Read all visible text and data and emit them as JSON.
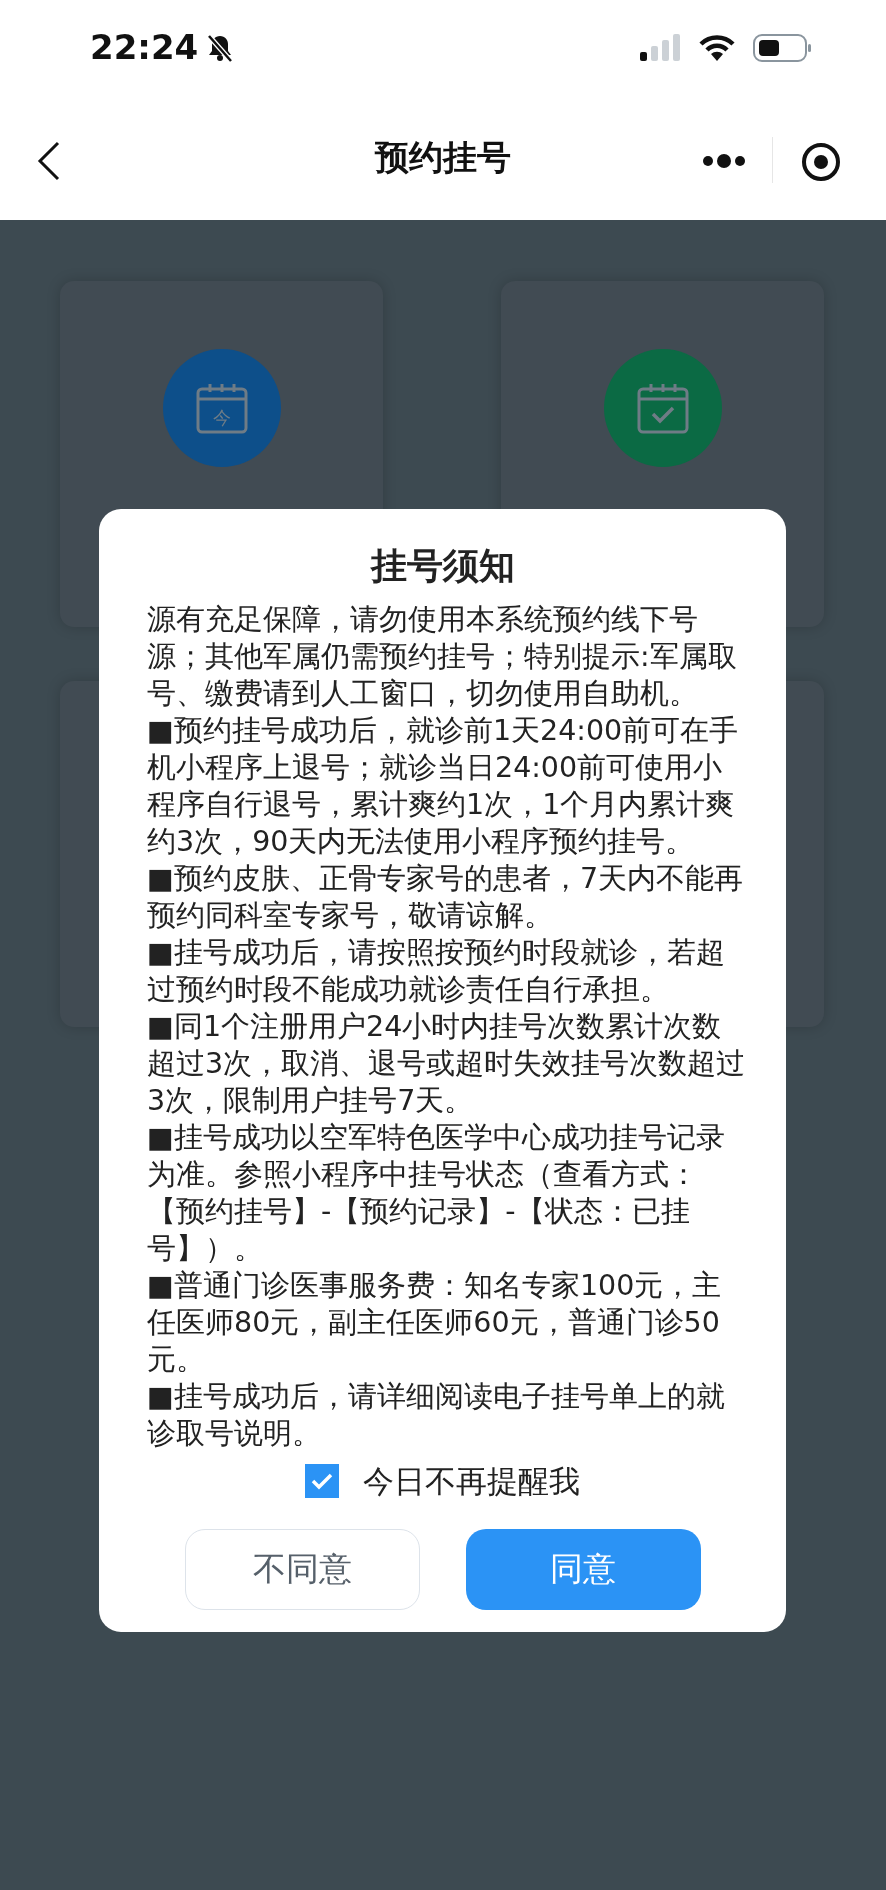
{
  "status_bar": {
    "time": "22:24"
  },
  "nav": {
    "title": "预约挂号"
  },
  "tiles": [
    {
      "kind": "today",
      "color": "#0d4f8a",
      "icon_text": "今"
    },
    {
      "kind": "check",
      "color": "#0b6a44"
    }
  ],
  "dialog": {
    "title": "挂号须知",
    "paragraphs": [
      "源有充足保障，请勿使用本系统预约线下号源；其他军属仍需预约挂号；特别提示:军属取号、缴费请到人工窗口，切勿使用自助机。",
      "■预约挂号成功后，就诊前1天24:00前可在手机小程序上退号；就诊当日24:00前可使用小程序自行退号，累计爽约1次，1个月内累计爽约3次，90天内无法使用小程序预约挂号。",
      "■预约皮肤、正骨专家号的患者，7天内不能再预约同科室专家号，敬请谅解。",
      "■挂号成功后，请按照按预约时段就诊，若超过预约时段不能成功就诊责任自行承担。",
      "■同1个注册用户24小时内挂号次数累计次数超过3次，取消、退号或超时失效挂号次数超过3次，限制用户挂号7天。",
      "■挂号成功以空军特色医学中心成功挂号记录为准。参照小程序中挂号状态（查看方式：【预约挂号】-【预约记录】-【状态：已挂号】）。",
      "■普通门诊医事服务费：知名专家100元，主任医师80元，副主任医师60元，普通门诊50元。",
      "■挂号成功后，请详细阅读电子挂号单上的就诊取号说明。"
    ],
    "remember": {
      "label": "今日不再提醒我",
      "checked": true
    },
    "buttons": [
      {
        "label": "不同意",
        "kind": "secondary"
      },
      {
        "label": "同意",
        "kind": "primary"
      }
    ]
  }
}
